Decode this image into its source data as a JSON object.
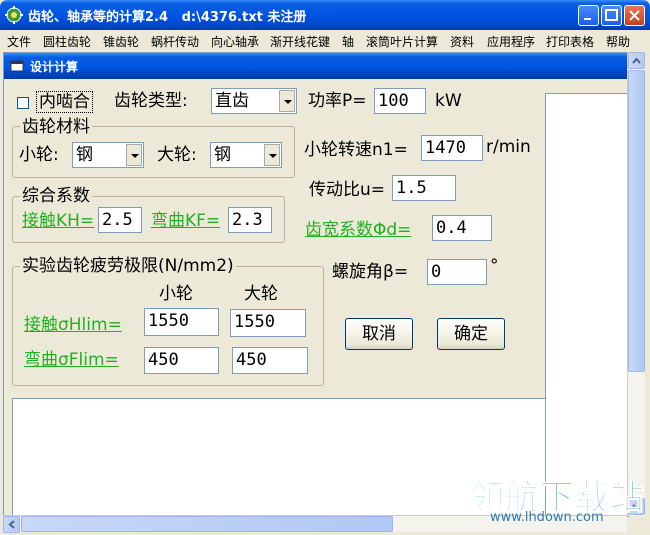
{
  "window": {
    "title": "齿轮、轴承等的计算2.4   d:\\4376.txt 未注册"
  },
  "menu": [
    "文件",
    "圆柱齿轮",
    "锥齿轮",
    "蜗杆传动",
    "向心轴承",
    "渐开线花键",
    "轴",
    "滚筒叶片计算",
    "资料",
    "应用程序",
    "打印表格",
    "帮助"
  ],
  "child": {
    "title": "设计计算"
  },
  "form": {
    "internal_gear_label": "内啮合",
    "internal_gear_checked": false,
    "gear_type_label": "齿轮类型:",
    "gear_type_value": "直齿",
    "power_label": "功率P=",
    "power_value": "100",
    "power_unit": "kW",
    "material_group": "齿轮材料",
    "small_gear_label": "小轮:",
    "small_gear_material": "钢",
    "large_gear_label": "大轮:",
    "large_gear_material": "钢",
    "speed_label": "小轮转速n1=",
    "speed_value": "1470",
    "speed_unit": "r/min",
    "ratio_label": "传动比u=",
    "ratio_value": "1.5",
    "factor_group": "综合系数",
    "kh_label": "接触KH=",
    "kh_value": "2.5",
    "kf_label": "弯曲KF=",
    "kf_value": "2.3",
    "width_label": "齿宽系数Φd=",
    "width_value": "0.4",
    "limit_group": "实验齿轮疲劳极限(N/mm2)",
    "col_small": "小轮",
    "col_large": "大轮",
    "hlim_label": "接触σHlim=",
    "hlim_small": "1550",
    "hlim_large": "1550",
    "flim_label": "弯曲σFlim=",
    "flim_small": "450",
    "flim_large": "450",
    "helix_label": "螺旋角β=",
    "helix_value": "0",
    "helix_unit": "°",
    "cancel_label": "取消",
    "ok_label": "确定"
  },
  "watermark": {
    "brand": "领航下载站",
    "url": "www.lhdown.com"
  },
  "colors": {
    "title_blue": "#0054e3",
    "link_green": "#22b022",
    "form_bg": "#ece9d8"
  }
}
